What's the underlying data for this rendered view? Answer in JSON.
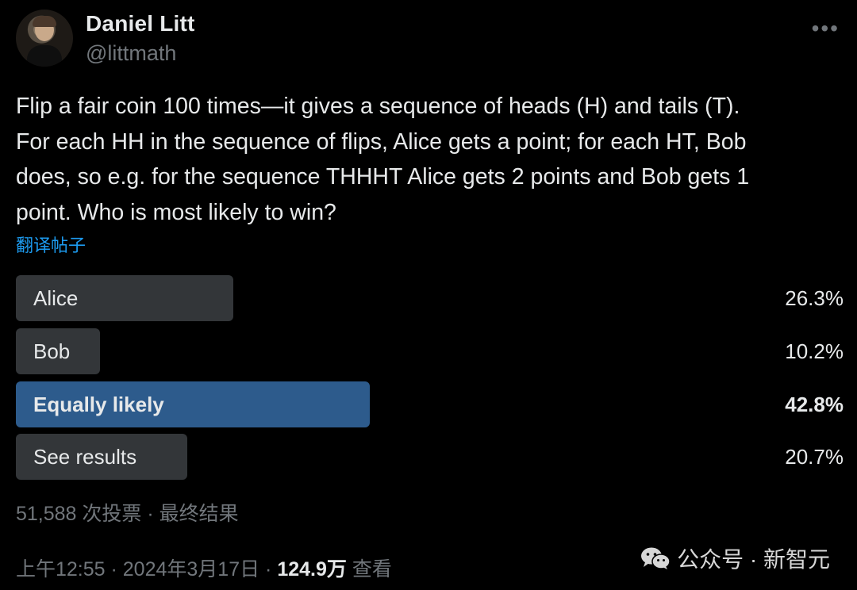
{
  "author": {
    "name": "Daniel Litt",
    "handle": "@littmath"
  },
  "menu_icon": "more-dots-icon",
  "tweet_text": "Flip a fair coin 100 times—it gives a sequence of heads (H) and tails (T).\nFor each HH in the sequence of flips, Alice gets a point; for each HT, Bob\ndoes, so e.g. for the sequence THHHT Alice gets 2 points and Bob gets 1\npoint. Who is most likely to win?",
  "translate_link": "翻译帖子",
  "poll": {
    "options": [
      {
        "label": "Alice",
        "percent": "26.3%",
        "fraction": 0.263,
        "winner": false
      },
      {
        "label": "Bob",
        "percent": "10.2%",
        "fraction": 0.102,
        "winner": false
      },
      {
        "label": "Equally likely",
        "percent": "42.8%",
        "fraction": 0.428,
        "winner": true
      },
      {
        "label": "See results",
        "percent": "20.7%",
        "fraction": 0.207,
        "winner": false
      }
    ],
    "summary": "51,588 次投票 · 最终结果"
  },
  "meta": {
    "time": "上午12:55 · 2024年3月17日 ·",
    "views_count": "124.9万",
    "views_label": "查看"
  },
  "watermark": {
    "icon": "wechat-icon",
    "text": "公众号 · 新智元"
  },
  "colors": {
    "background": "#000000",
    "bar": "#333639",
    "winner_bar": "#2d5b8c",
    "link": "#1d9bf0",
    "muted": "#71767b"
  }
}
